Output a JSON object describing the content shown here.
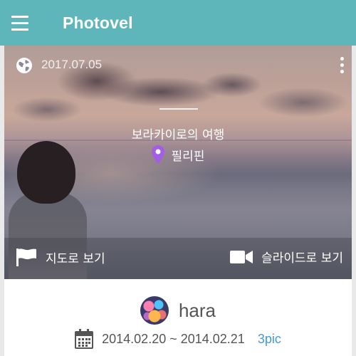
{
  "appbar": {
    "title": "Photovel",
    "menu_icon": "hamburger-menu-icon"
  },
  "trip": {
    "date": "2017.07.05",
    "title": "보라카이로의 여행",
    "location": "필리핀",
    "globe_icon": "globe-icon",
    "more_icon": "more-vertical-icon",
    "pin_icon": "location-pin-icon",
    "pin_color": "#a45ee5",
    "actions": {
      "map_label": "지도로 보기",
      "map_icon": "flag-icon",
      "slide_label": "슬라이드로 보기",
      "slide_icon": "video-camera-icon"
    }
  },
  "author": {
    "name": "hara",
    "avatar_icon": "avatar"
  },
  "period": {
    "range": "2014.02.20 ~ 2014.02.21",
    "count": "3pic",
    "calendar_icon": "calendar-icon",
    "count_color": "#3d9be0"
  },
  "colors": {
    "appbar": "#5fb6ba",
    "background": "#e9e9e9"
  }
}
